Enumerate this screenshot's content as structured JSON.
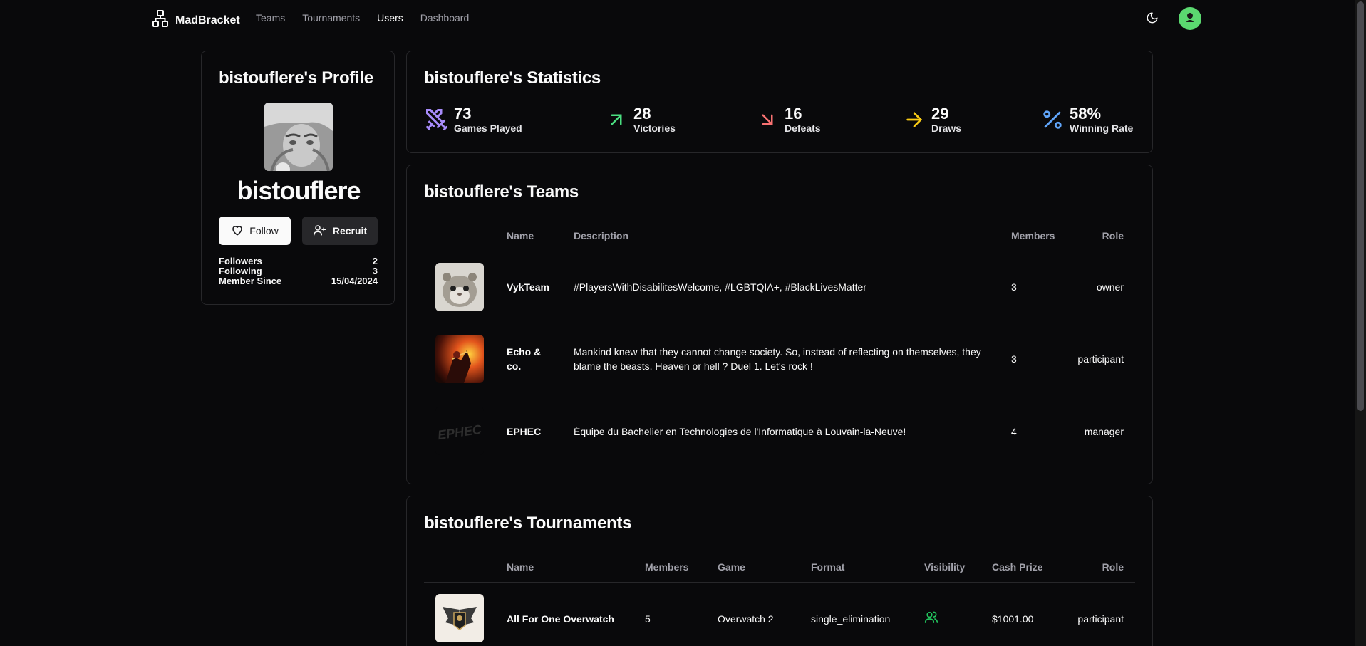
{
  "nav": {
    "brand": "MadBracket",
    "links": [
      "Teams",
      "Tournaments",
      "Users",
      "Dashboard"
    ]
  },
  "profile": {
    "title": "bistouflere's Profile",
    "username": "bistouflere",
    "follow_label": "Follow",
    "recruit_label": "Recruit",
    "stats": [
      {
        "label": "Followers",
        "value": "2"
      },
      {
        "label": "Following",
        "value": "3"
      },
      {
        "label": "Member Since",
        "value": "15/04/2024"
      }
    ]
  },
  "statistics": {
    "title": "bistouflere's Statistics",
    "items": [
      {
        "value": "73",
        "label": "Games Played",
        "icon": "swords-icon",
        "color": "#a78bfa"
      },
      {
        "value": "28",
        "label": "Victories",
        "icon": "arrow-up-right-icon",
        "color": "#4ade80"
      },
      {
        "value": "16",
        "label": "Defeats",
        "icon": "arrow-down-right-icon",
        "color": "#f87171"
      },
      {
        "value": "29",
        "label": "Draws",
        "icon": "arrow-right-icon",
        "color": "#facc15"
      },
      {
        "value": "58%",
        "label": "Winning Rate",
        "icon": "percent-icon",
        "color": "#60a5fa"
      }
    ]
  },
  "teams": {
    "title": "bistouflere's Teams",
    "headers": [
      "Name",
      "Description",
      "Members",
      "Role"
    ],
    "rows": [
      {
        "name": "VykTeam",
        "description": "#PlayersWithDisabilitesWelcome, #LGBTQIA+, #BlackLivesMatter",
        "members": "3",
        "role": "owner"
      },
      {
        "name": "Echo & co.",
        "description": "Mankind knew that they cannot change society. So, instead of reflecting on themselves, they blame the beasts. Heaven or hell ? Duel 1. Let's rock !",
        "members": "3",
        "role": "participant"
      },
      {
        "name": "EPHEC",
        "description": "Équipe du Bachelier en Technologies de l'Informatique à Louvain-la-Neuve!",
        "members": "4",
        "role": "manager",
        "logo_text": "EPHEC"
      }
    ]
  },
  "tournaments": {
    "title": "bistouflere's Tournaments",
    "headers": [
      "Name",
      "Members",
      "Game",
      "Format",
      "Visibility",
      "Cash Prize",
      "Role"
    ],
    "rows": [
      {
        "name": "All For One Overwatch",
        "members": "5",
        "game": "Overwatch 2",
        "format": "single_elimination",
        "visibility_icon": "users-icon",
        "cash_prize": "$1001.00",
        "role": "participant"
      }
    ]
  }
}
